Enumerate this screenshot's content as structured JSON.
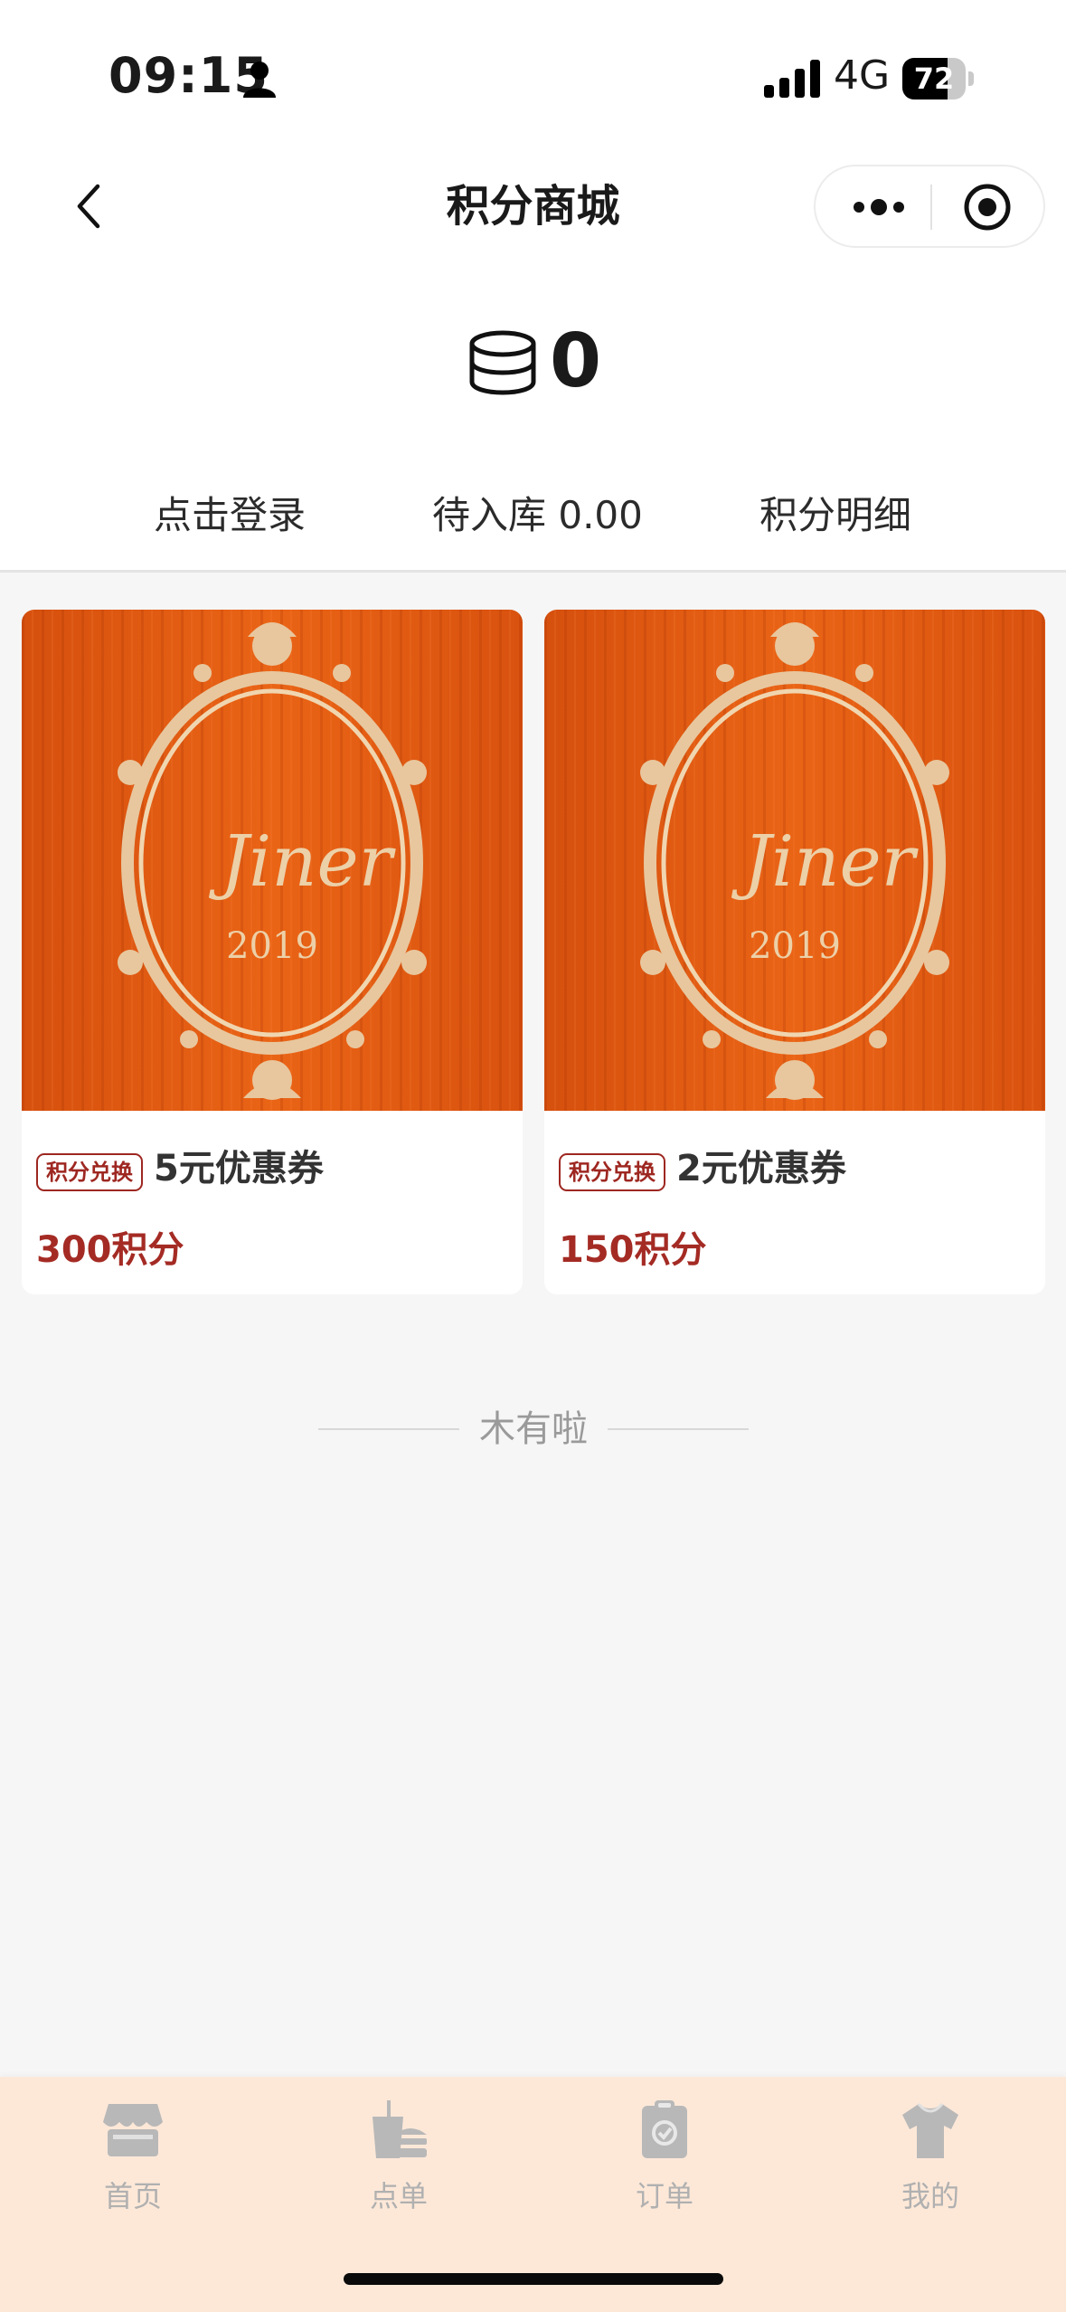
{
  "status_bar": {
    "time": "09:15",
    "network": "4G",
    "battery": "72",
    "battery_level": 0.72
  },
  "nav": {
    "title": "积分商城"
  },
  "points": {
    "value": "0"
  },
  "actions": {
    "login": "点击登录",
    "pending": "待入库 0.00",
    "detail": "积分明细"
  },
  "products": [
    {
      "tag": "积分兑换",
      "name": "5元优惠券",
      "price": "300积分",
      "image_script": "Jiner",
      "image_year": "2019"
    },
    {
      "tag": "积分兑换",
      "name": "2元优惠券",
      "price": "150积分",
      "image_script": "Jiner",
      "image_year": "2019"
    }
  ],
  "end_text": "木有啦",
  "tabbar": [
    {
      "label": "首页",
      "icon": "store-icon"
    },
    {
      "label": "点单",
      "icon": "drink-burger-icon"
    },
    {
      "label": "订单",
      "icon": "order-clipboard-icon"
    },
    {
      "label": "我的",
      "icon": "shirt-icon"
    }
  ],
  "colors": {
    "accent": "#a42b24",
    "tabbar_bg": "#fde8d8",
    "product_image_bg": "#e25d14",
    "ornament": "#e8c79e"
  }
}
